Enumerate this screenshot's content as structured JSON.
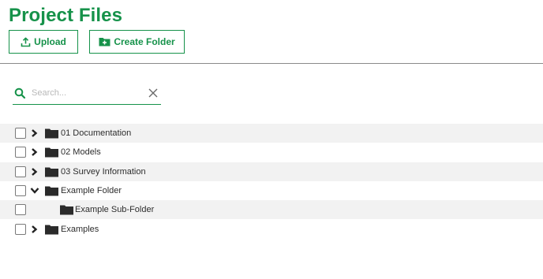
{
  "header": {
    "title": "Project Files",
    "upload_label": "Upload",
    "create_folder_label": "Create Folder"
  },
  "search": {
    "placeholder": "Search...",
    "value": ""
  },
  "colors": {
    "accent": "#16924a",
    "row_shade": "#f2f2f2",
    "folder": "#2b2b2b"
  },
  "tree": {
    "items": [
      {
        "label": "01 Documentation",
        "expanded": false,
        "level": 0
      },
      {
        "label": "02 Models",
        "expanded": false,
        "level": 0
      },
      {
        "label": "03 Survey Information",
        "expanded": false,
        "level": 0
      },
      {
        "label": "Example Folder",
        "expanded": true,
        "level": 0
      },
      {
        "label": "Example Sub-Folder",
        "expanded": false,
        "level": 1
      },
      {
        "label": "Examples",
        "expanded": false,
        "level": 0
      }
    ]
  }
}
